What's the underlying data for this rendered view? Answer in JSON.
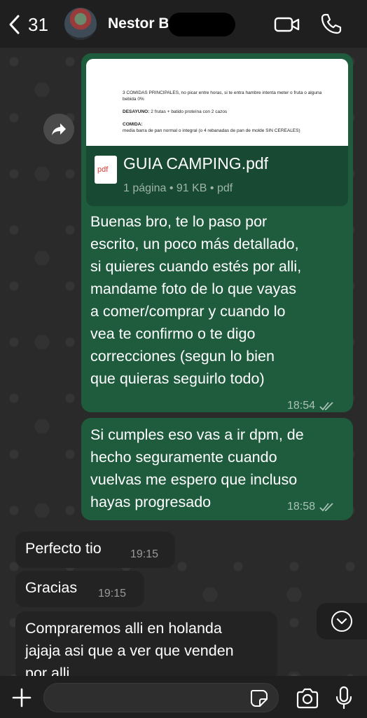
{
  "header": {
    "back_count": "31",
    "contact_name": "Nestor B"
  },
  "document_message": {
    "preview_lines": [
      "3 COMIDAS PRINCIPALES, no picar entre horas, si te entra hambre intenta meter o fruta o alguna bebida 0%",
      "DESAYUNO:",
      "2 frutas + batido proteína con 2 cazos",
      "COMIDA:",
      "media barra de pan normal o integral (o 4 rebanadas de pan de molde SIN CEREALES)"
    ],
    "file_name": "GUIA CAMPING.pdf",
    "file_meta": "1 página • 91 KB • pdf",
    "icon_label": "pdf",
    "text_lines": [
      "Buenas bro, te lo paso por",
      "escrito, un poco más detallado,",
      "si quieres cuando estés por alli,",
      "mandame foto de lo que vayas",
      "a comer/comprar y cuando lo",
      "vea te confirmo o te digo",
      "correcciones (segun lo bien",
      "que quieras seguirlo todo)"
    ],
    "time": "18:54"
  },
  "outgoing_message_2": {
    "text_lines": [
      "Si cumples eso vas a ir dpm, de",
      "hecho seguramente cuando",
      "vuelvas me espero que incluso",
      "hayas progresado"
    ],
    "time": "18:58"
  },
  "incoming_messages": [
    {
      "text": "Perfecto tio",
      "time": "19:15"
    },
    {
      "text": "Gracias",
      "time": "19:15"
    },
    {
      "text_lines": [
        "Compraremos alli en holanda",
        "jajaja asi que a ver que venden",
        "por alli"
      ],
      "time": ""
    }
  ],
  "composer": {
    "placeholder": "",
    "value": ""
  },
  "colors": {
    "outgoing_bubble": "#1f5c3e",
    "incoming_bubble": "#232323",
    "header_bg": "#1f1f1f",
    "chat_bg": "#2a2a2a",
    "accent_ticks": "#a9c2b4"
  },
  "icons": {
    "back": "chevron-left-icon",
    "video": "video-camera-icon",
    "call": "phone-icon",
    "forward": "forward-arrow-icon",
    "read_receipt": "double-check-icon",
    "scroll_down": "chevron-down-circle-icon",
    "attach": "plus-icon",
    "sticker": "sticker-icon",
    "camera": "camera-icon",
    "mic": "microphone-icon"
  }
}
